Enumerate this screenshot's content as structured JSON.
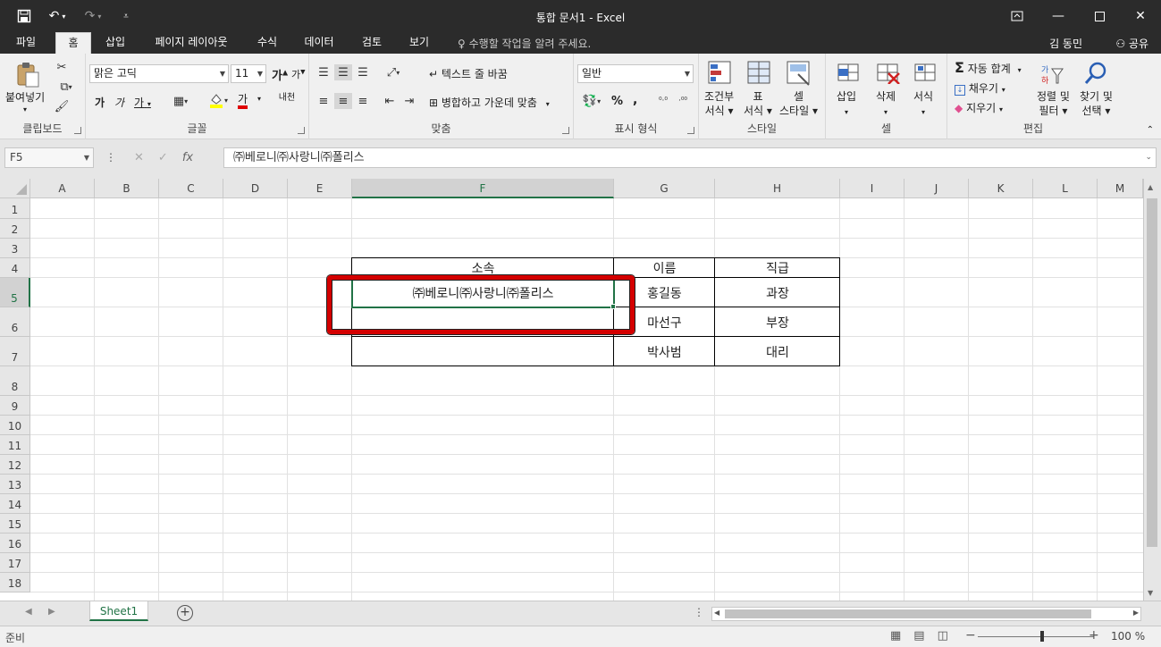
{
  "window": {
    "title": "통합 문서1 - Excel",
    "qat": {
      "save_icon": "save-icon",
      "undo_icon": "undo-icon",
      "redo_icon": "redo-icon",
      "customize_icon": "customize-qat-icon"
    },
    "controls": {
      "ribbon_options": "ribbon-display-options-icon",
      "minimize": "minimize-icon",
      "maximize": "maximize-icon",
      "close": "close-icon"
    }
  },
  "tabs": [
    {
      "label": "파일"
    },
    {
      "label": "홈"
    },
    {
      "label": "삽입"
    },
    {
      "label": "페이지 레이아웃"
    },
    {
      "label": "수식"
    },
    {
      "label": "데이터"
    },
    {
      "label": "검토"
    },
    {
      "label": "보기"
    }
  ],
  "active_tab": "홈",
  "tell_me": "수행할 작업을 알려 주세요.",
  "user": "김 동민",
  "share": "공유",
  "ribbon": {
    "clipboard": {
      "label": "클립보드",
      "paste": "붙여넣기"
    },
    "font": {
      "label": "글꼴",
      "name": "맑은 고딕",
      "size": "11",
      "bold": "가",
      "italic": "가",
      "underline": "가",
      "grow": "가",
      "shrink": "가",
      "font_color": "가",
      "phonetic": "내천"
    },
    "alignment": {
      "label": "맞춤",
      "wrap": "텍스트 줄 바꿈",
      "merge": "병합하고 가운데 맞춤"
    },
    "number": {
      "label": "표시 형식",
      "format": "일반",
      "percent": "%",
      "comma": ","
    },
    "styles": {
      "label": "스타일",
      "conditional": [
        "조건부",
        "서식"
      ],
      "table": [
        "표",
        "서식"
      ],
      "cell_styles": [
        "셀",
        "스타일"
      ]
    },
    "cells": {
      "label": "셀",
      "insert": "삽입",
      "delete": "삭제",
      "format": "서식"
    },
    "editing": {
      "label": "편집",
      "autosum": "자동 합계",
      "fill": "채우기",
      "clear": "지우기",
      "sort": [
        "정렬 및",
        "필터"
      ],
      "find": [
        "찾기 및",
        "선택"
      ]
    }
  },
  "formula_bar": {
    "name_box": "F5",
    "cancel": "✕",
    "enter": "✓",
    "fx": "fx",
    "content": "㈜베로니㈜사랑니㈜폴리스"
  },
  "columns": [
    "A",
    "B",
    "C",
    "D",
    "E",
    "F",
    "G",
    "H",
    "I",
    "J",
    "K",
    "L",
    "M"
  ],
  "rows": [
    "1",
    "2",
    "3",
    "4",
    "5",
    "6",
    "7",
    "8",
    "9",
    "10",
    "11",
    "12",
    "13",
    "14",
    "15",
    "16",
    "17",
    "18"
  ],
  "selected_column": "F",
  "selected_row": "5",
  "table": {
    "headers": [
      "소속",
      "이름",
      "직급"
    ],
    "rows": [
      [
        "㈜베로니㈜사랑니㈜폴리스",
        "홍길동",
        "과장"
      ],
      [
        "",
        "마선구",
        "부장"
      ],
      [
        "",
        "박사범",
        "대리"
      ]
    ]
  },
  "sheet_tab": "Sheet1",
  "status": {
    "ready": "준비",
    "zoom": "100 %",
    "zoom_out": "−",
    "zoom_in": "+"
  }
}
